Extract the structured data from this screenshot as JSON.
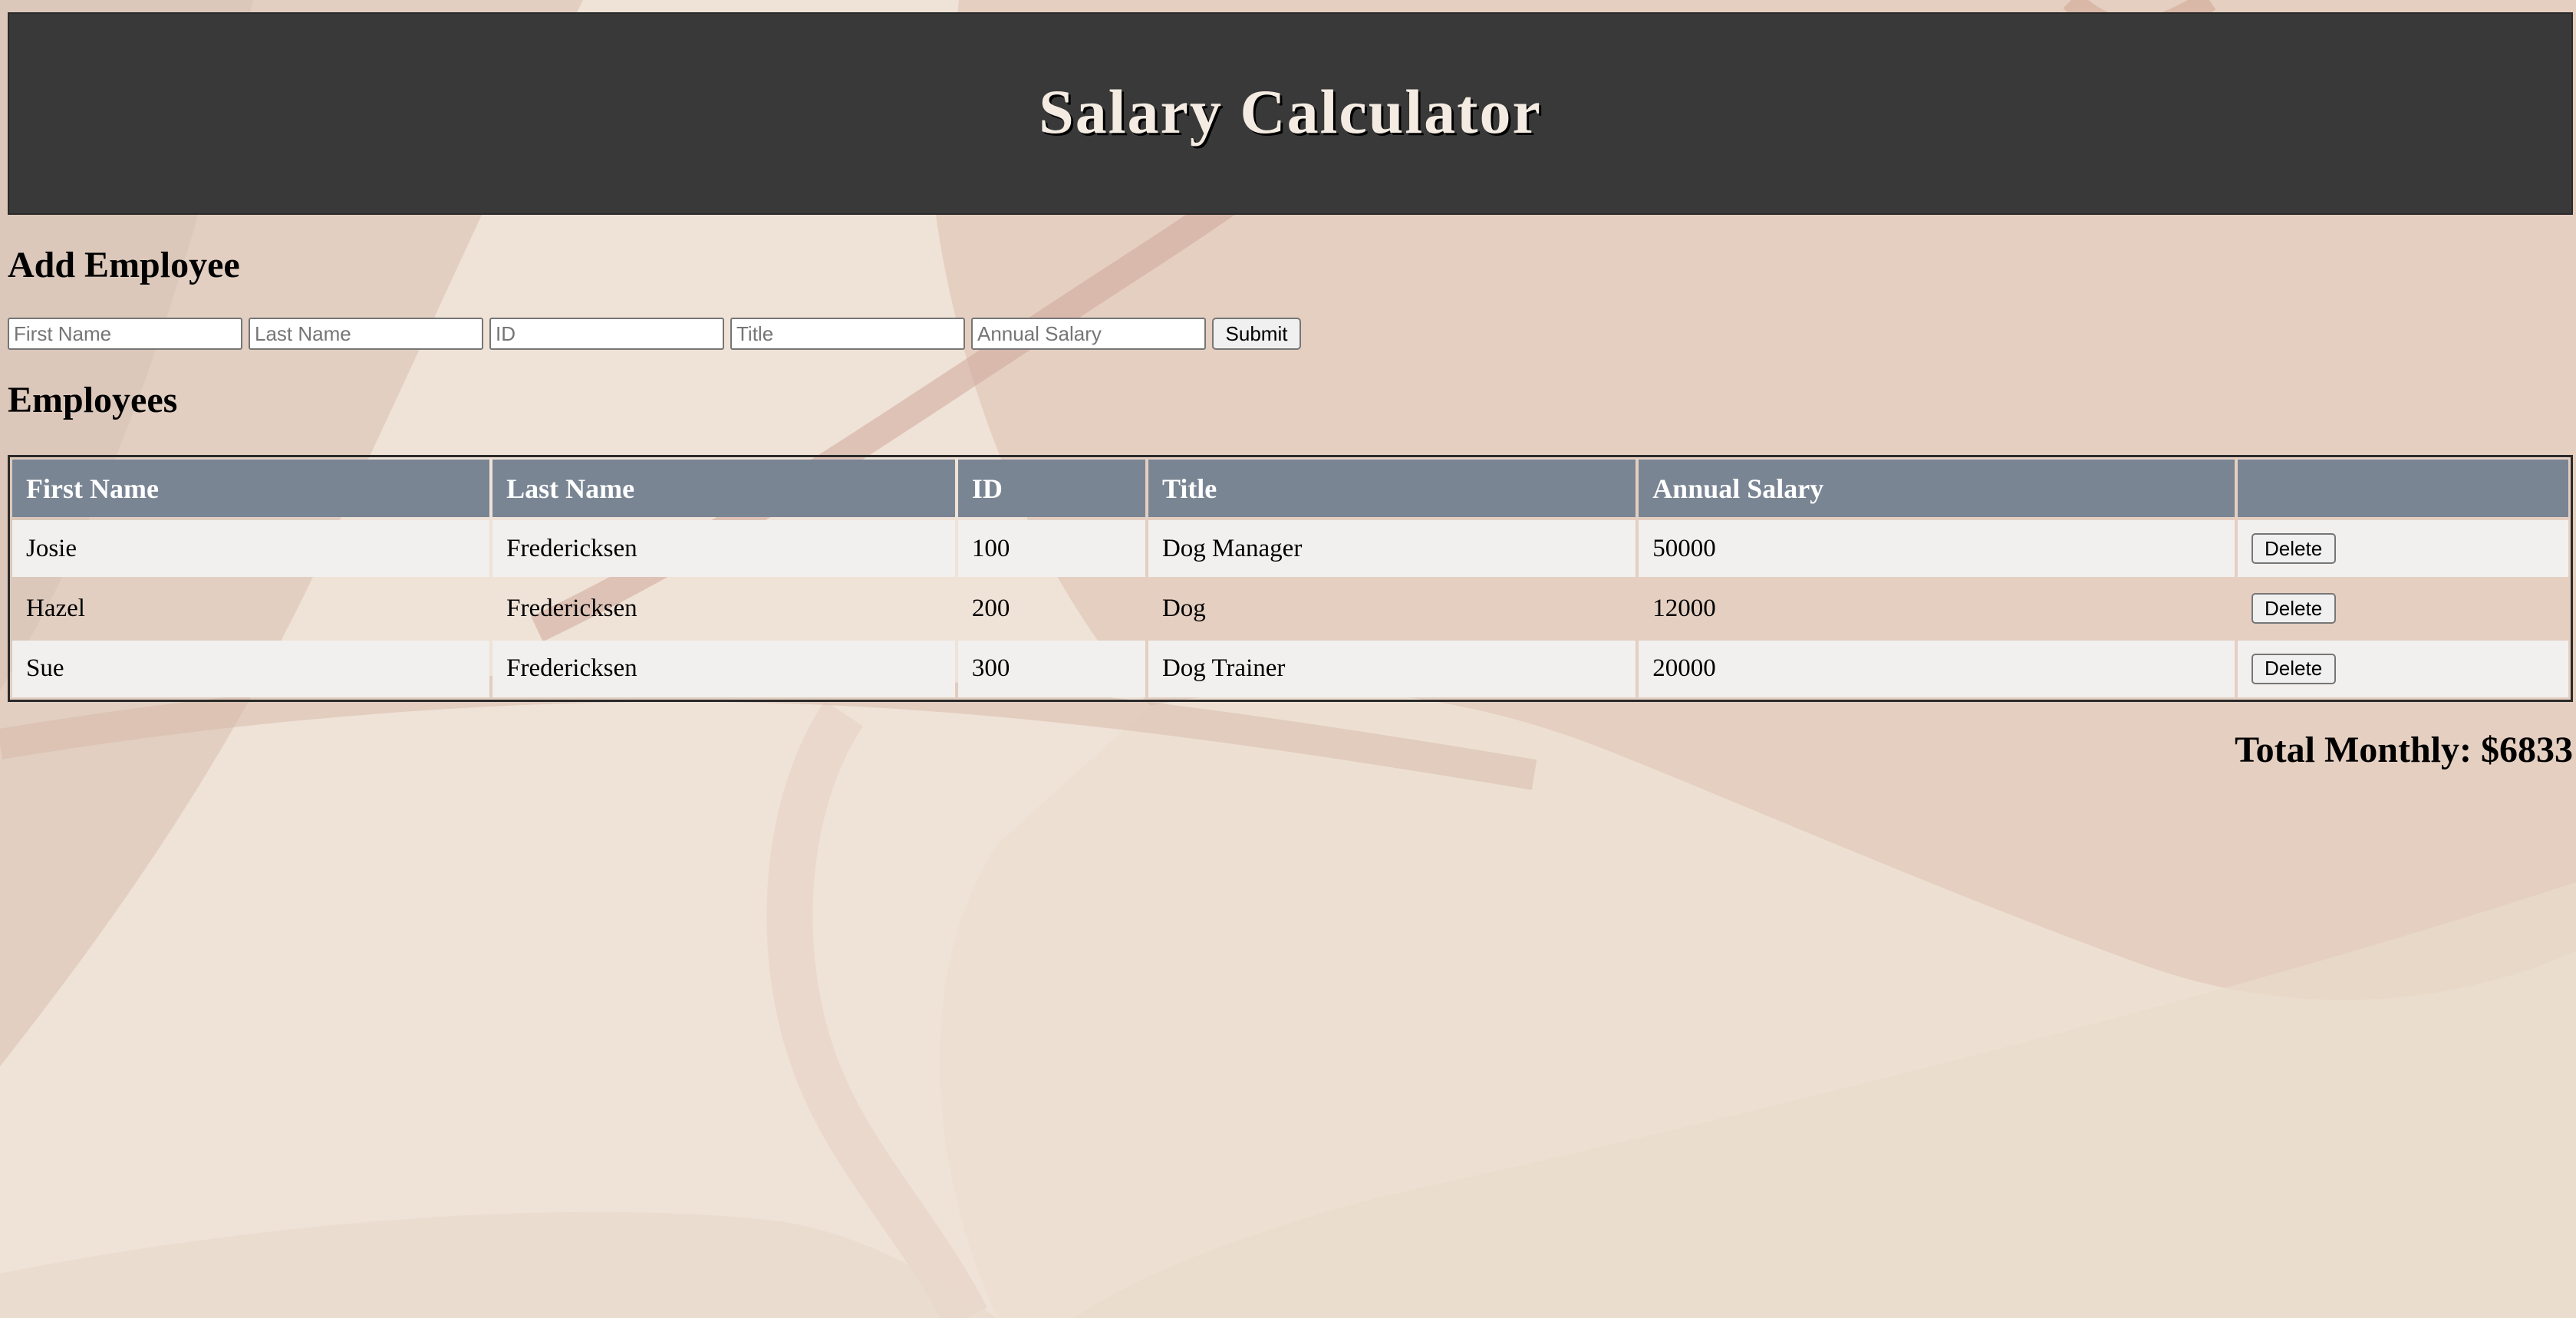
{
  "header": {
    "title": "Salary Calculator"
  },
  "add_section": {
    "heading": "Add Employee"
  },
  "form": {
    "first_name_placeholder": "First Name",
    "last_name_placeholder": "Last Name",
    "id_placeholder": "ID",
    "title_placeholder": "Title",
    "salary_placeholder": "Annual Salary",
    "submit_label": "Submit"
  },
  "employees_section": {
    "heading": "Employees"
  },
  "table": {
    "columns": [
      "First Name",
      "Last Name",
      "ID",
      "Title",
      "Annual Salary",
      ""
    ],
    "rows": [
      {
        "first": "Josie",
        "last": "Fredericksen",
        "id": "100",
        "title": "Dog Manager",
        "salary": "50000",
        "action": "Delete"
      },
      {
        "first": "Hazel",
        "last": "Fredericksen",
        "id": "200",
        "title": "Dog",
        "salary": "12000",
        "action": "Delete"
      },
      {
        "first": "Sue",
        "last": "Fredericksen",
        "id": "300",
        "title": "Dog Trainer",
        "salary": "20000",
        "action": "Delete"
      }
    ]
  },
  "total": {
    "text": "Total Monthly: $6833"
  },
  "colors": {
    "banner": "#393939",
    "banner_text": "#f4ece2",
    "table_header": "#7a8594",
    "row_light": "#f1f0ef",
    "background": "#ecdcd0"
  }
}
